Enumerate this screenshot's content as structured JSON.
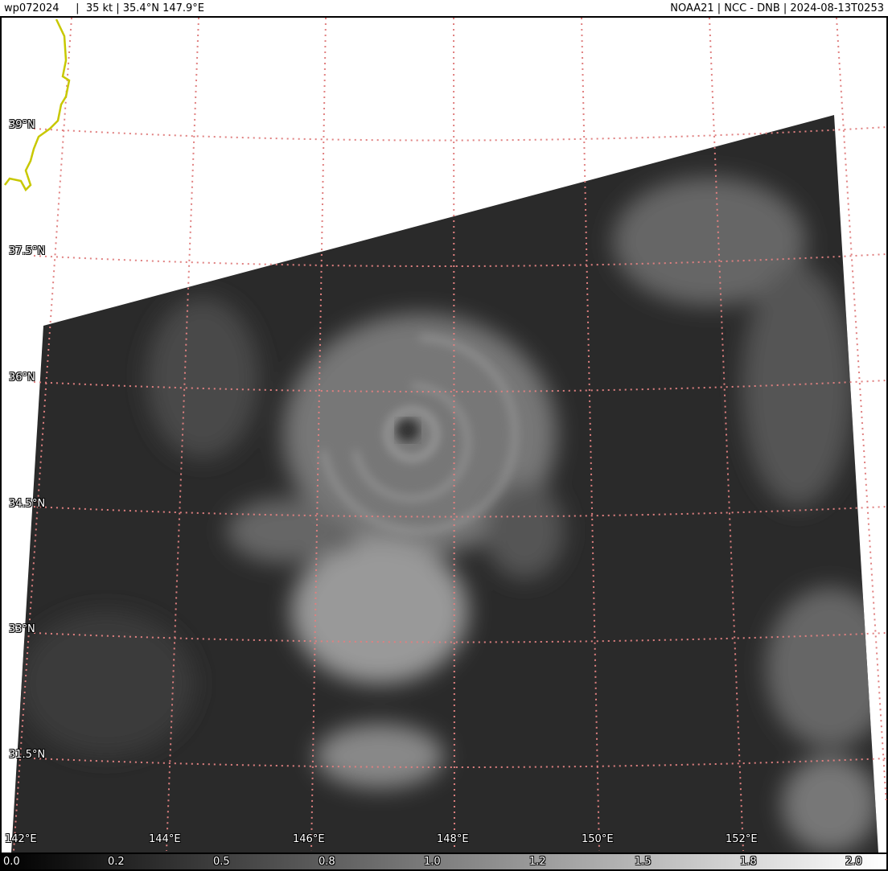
{
  "header": {
    "left": "wp072024     |  35 kt | 35.4°N 147.9°E",
    "right": "NOAA21 | NCC - DNB | 2024-08-13T0253"
  },
  "lat_labels": [
    "39°N",
    "37.5°N",
    "36°N",
    "34.5°N",
    "33°N",
    "31.5°N"
  ],
  "lon_labels": [
    "142°E",
    "144°E",
    "146°E",
    "148°E",
    "150°E",
    "152°E"
  ],
  "colorbar": {
    "ticks": [
      "0.0",
      "0.2",
      "0.5",
      "0.8",
      "1.0",
      "1.2",
      "1.5",
      "1.8",
      "2.0"
    ]
  },
  "colors": {
    "grid": "#e08080",
    "coastline": "#c8c800",
    "ocean": "#2c2c2c"
  }
}
